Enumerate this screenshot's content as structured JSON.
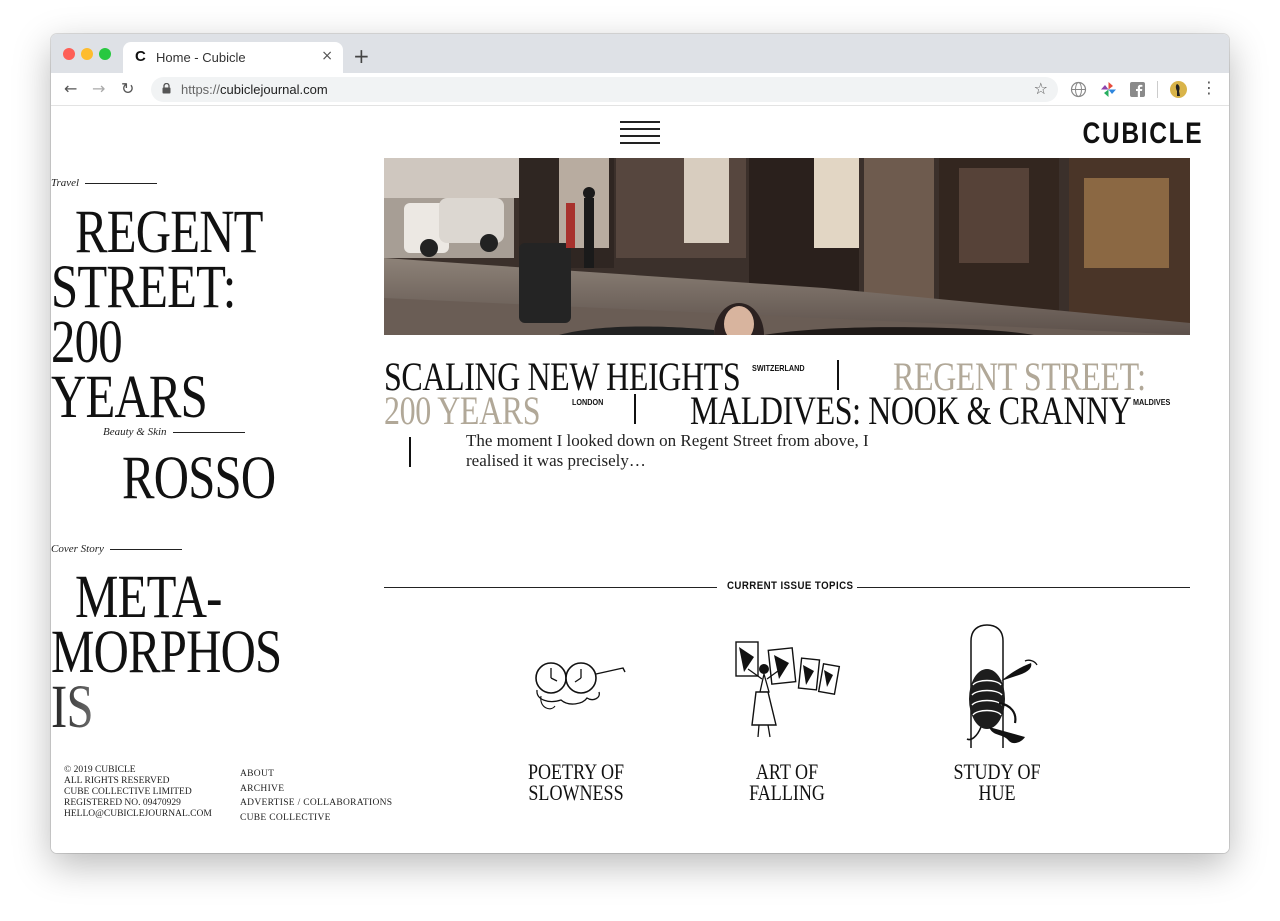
{
  "browser": {
    "tab_favicon": "C",
    "tab_title": "Home - Cubicle",
    "tab_close": "×",
    "new_tab": "+",
    "back": "←",
    "forward": "→",
    "reload": "↻",
    "url_scheme": "https://",
    "url_host": "cubiclejournal.com",
    "bookmark_star": "☆",
    "menu_dots": "⋮"
  },
  "site": {
    "logo": "CUBICLE"
  },
  "sidebar": {
    "stories": [
      {
        "category": "Travel",
        "title": "REGENT STREET: 200 YEARS"
      },
      {
        "category": "Beauty & Skin",
        "title": "ROSSO"
      },
      {
        "category": "Cover Story",
        "title": "META- MORPHOS IS"
      }
    ]
  },
  "featured": {
    "headline_1": "SCALING NEW HEIGHTS",
    "loc_1": "SWITZERLAND",
    "headline_2a": "REGENT STREET:",
    "headline_2b": "200 YEARS",
    "loc_2": "LONDON",
    "headline_3": "MALDIVES: NOOK & CRANNY",
    "loc_3": "MALDIVES",
    "excerpt_line_1": "The moment I looked down on Regent Street from above, I",
    "excerpt_line_2": "realised it was precisely…",
    "accent_color": "#b1a898"
  },
  "topics": {
    "label": "CURRENT ISSUE TOPICS",
    "items": [
      {
        "line1": "POETRY OF",
        "line2": "SLOWNESS",
        "icon": "melting-glasses-clock-icon"
      },
      {
        "line1": "ART OF",
        "line2": "FALLING",
        "icon": "falling-figure-frames-icon"
      },
      {
        "line1": "STUDY OF",
        "line2": "HUE",
        "icon": "octopus-jar-icon"
      }
    ]
  },
  "footer": {
    "left": [
      "© 2019 CUBICLE",
      "ALL RIGHTS RESERVED",
      "CUBE COLLECTIVE LIMITED",
      "REGISTERED NO. 09470929",
      "HELLO@CUBICLEJOURNAL.COM"
    ],
    "links": [
      "ABOUT",
      "ARCHIVE",
      "ADVERTISE / COLLABORATIONS",
      "CUBE COLLECTIVE"
    ]
  }
}
